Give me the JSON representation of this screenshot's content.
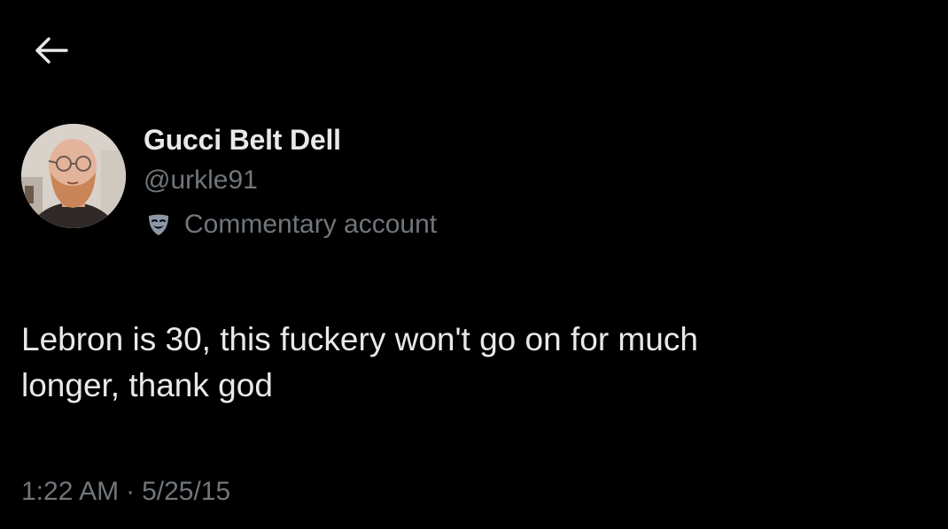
{
  "header": {
    "back_icon": "arrow-left-icon"
  },
  "author": {
    "display_name": "Gucci Belt Dell",
    "handle": "@urkle91",
    "label_icon": "theater-mask-icon",
    "label": "Commentary account"
  },
  "tweet": {
    "text": "Lebron is 30, this fuckery won't go on for much\nlonger, thank god",
    "time": "1:22 AM",
    "separator": "·",
    "date": "5/25/15"
  },
  "colors": {
    "background": "#000000",
    "primary_text": "#e7e9ea",
    "secondary_text": "#71767b",
    "label_icon": "#8b98a5"
  }
}
